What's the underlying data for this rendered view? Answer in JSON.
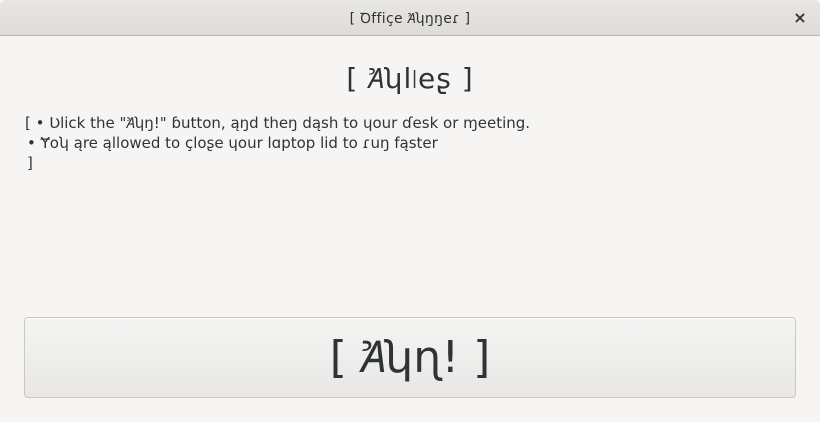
{
  "window": {
    "title": "[ Ꝺffiçe Ꞻʮŋŋeɾ ]",
    "close_label": "×"
  },
  "rules": {
    "heading": "[ Ꞻʮl৷eʂ ]",
    "open_bracket": "[",
    "items": [
      "• Ʋlick the \"Ꞻʮŋ!\" ɓutton, ąŋd theŋ dąsh to ɥour ɗesk or ɱeeting.",
      "• Ɏoʮ ąre ąllowed to çloʂe ɥour lɑptop lid to ɾuŋ fąster"
    ],
    "close_bracket": "]"
  },
  "run_button": {
    "label": "[ Ꞻʮɳ! ]"
  }
}
